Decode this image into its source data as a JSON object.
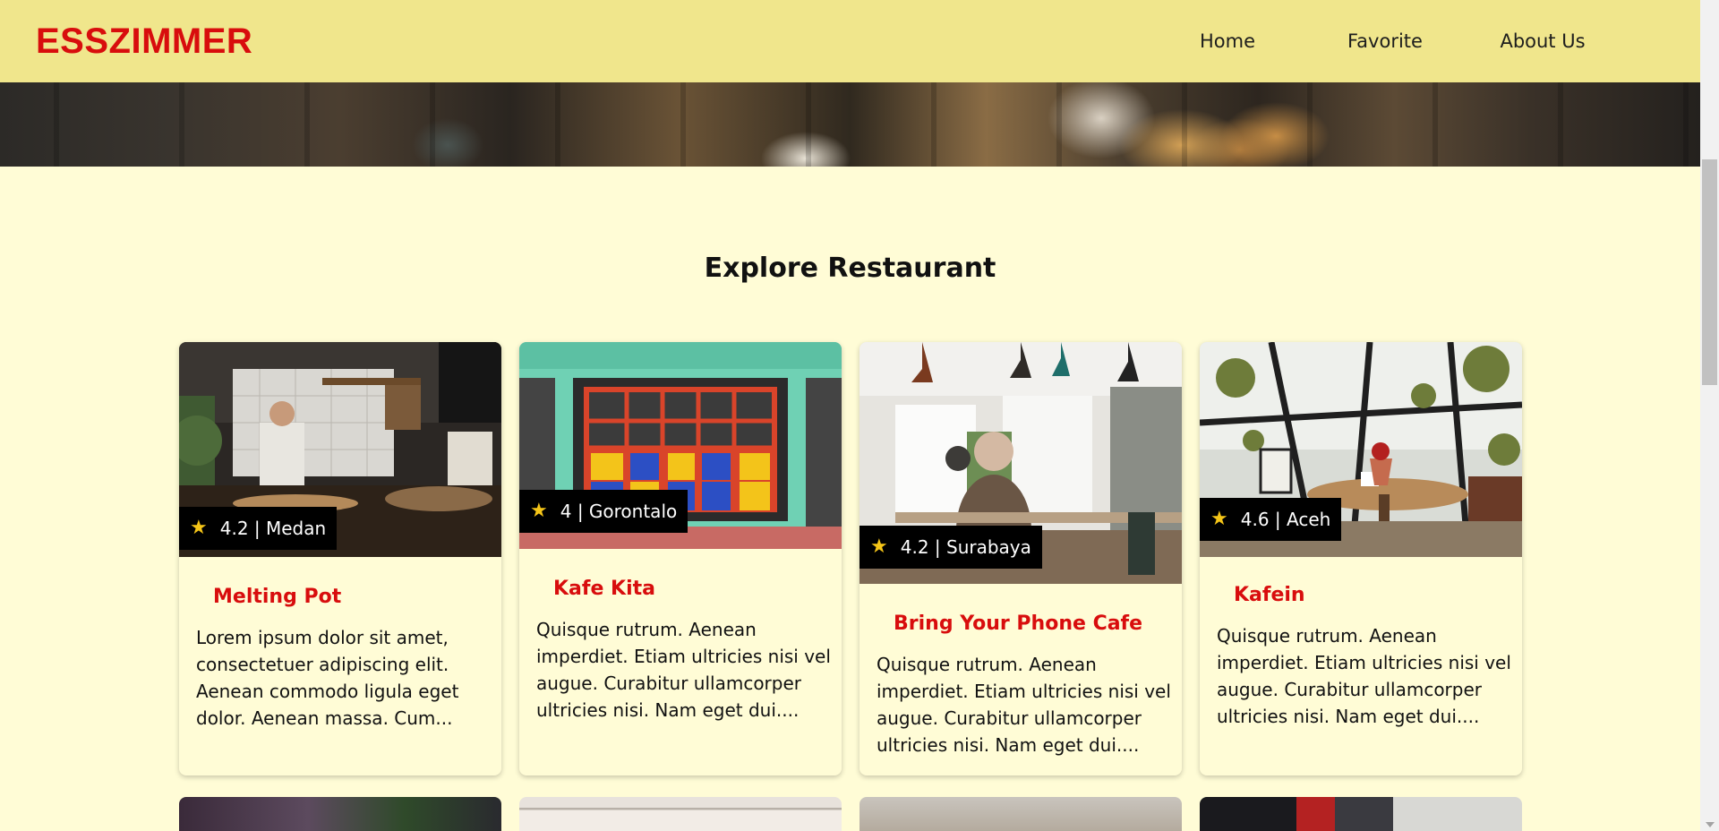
{
  "header": {
    "brand": "ESSZIMMER",
    "nav": [
      {
        "label": "Home"
      },
      {
        "label": "Favorite"
      },
      {
        "label": "About Us"
      }
    ]
  },
  "main": {
    "title": "Explore Restaurant",
    "restaurants": [
      {
        "name": "Melting Pot",
        "rating_city": "4.2 | Medan",
        "description": "Lorem ipsum dolor sit amet, consectetuer adipiscing elit. Aenean commodo ligula eget dolor. Aenean massa. Cum..."
      },
      {
        "name": "Kafe Kita",
        "rating_city": "4 | Gorontalo",
        "description": "Quisque rutrum. Aenean imperdiet. Etiam ultricies nisi vel augue. Curabitur ullamcorper ultricies nisi. Nam eget dui...."
      },
      {
        "name": "Bring Your Phone Cafe",
        "rating_city": "4.2 | Surabaya",
        "description": "Quisque rutrum. Aenean imperdiet. Etiam ultricies nisi vel augue. Curabitur ullamcorper ultricies nisi. Nam eget dui...."
      },
      {
        "name": "Kafein",
        "rating_city": "4.6 | Aceh",
        "description": "Quisque rutrum. Aenean imperdiet. Etiam ultricies nisi vel augue. Curabitur ullamcorper ultricies nisi. Nam eget dui...."
      }
    ]
  },
  "colors": {
    "header_bg": "#f0e68c",
    "page_bg": "#fffcd6",
    "brand": "#d80d0d",
    "badge_bg": "#000000",
    "star": "#f5c518"
  }
}
